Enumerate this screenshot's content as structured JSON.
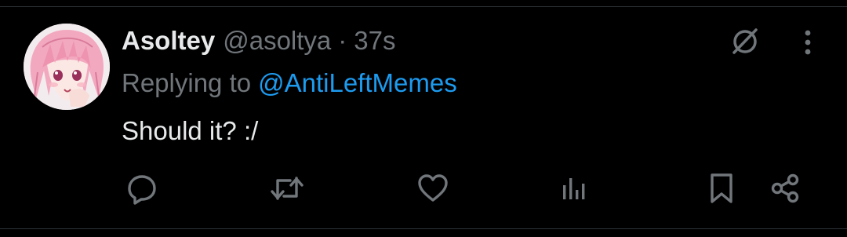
{
  "tweet": {
    "author": {
      "display_name": "Asoltey",
      "handle": "@asoltya",
      "avatar": "anime-avatar-pink-hair"
    },
    "separator": "·",
    "timestamp": "37s",
    "reply_prefix": "Replying to",
    "reply_to": "@AntiLeftMemes",
    "text": "Should it? :/"
  },
  "header_icons": {
    "grok": "grok-slash-circle-icon",
    "more": "more-vertical-icon"
  },
  "actions": [
    {
      "name": "reply",
      "icon": "reply-bubble-icon"
    },
    {
      "name": "retweet",
      "icon": "retweet-icon"
    },
    {
      "name": "like",
      "icon": "heart-icon"
    },
    {
      "name": "views",
      "icon": "views-bar-chart-icon"
    },
    {
      "name": "bookmark",
      "icon": "bookmark-icon"
    },
    {
      "name": "share",
      "icon": "share-icon"
    }
  ],
  "colors": {
    "background": "#000000",
    "primary_text": "#e7e9ea",
    "secondary_text": "#71767b",
    "link": "#1d9bf0",
    "divider": "#2f3336"
  }
}
